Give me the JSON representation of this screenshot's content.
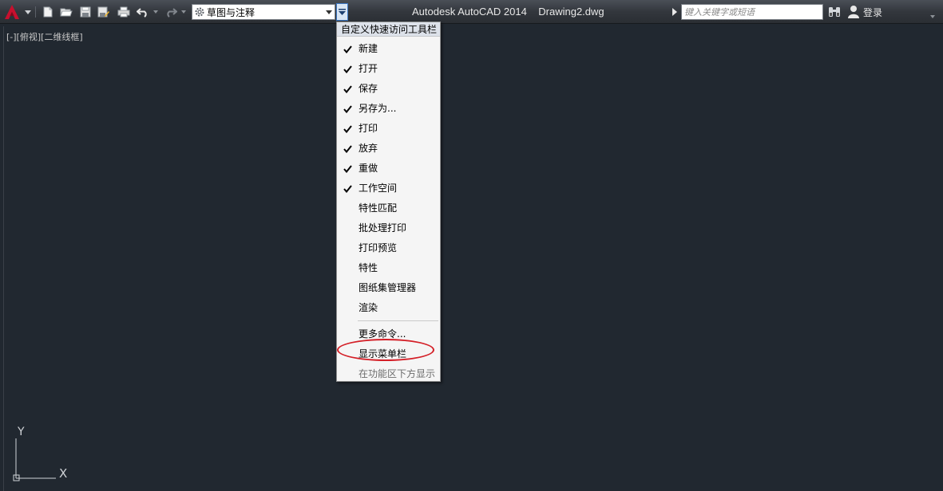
{
  "title_bar": {
    "window_title": "Autodesk AutoCAD 2014    Drawing2.dwg",
    "workspace": "草图与注释",
    "search_placeholder": "键入关键字或短语",
    "login": "登录"
  },
  "quick_access_icons": [
    "new-file-icon",
    "open-folder-icon",
    "save-icon",
    "save-as-icon",
    "print-icon",
    "undo-icon",
    "redo-icon"
  ],
  "viewport_label": "[-][俯视][二维线框]",
  "qat_menu": {
    "header": "自定义快速访问工具栏",
    "items": [
      {
        "label": "新建",
        "checked": true
      },
      {
        "label": "打开",
        "checked": true
      },
      {
        "label": "保存",
        "checked": true
      },
      {
        "label": "另存为...",
        "checked": true
      },
      {
        "label": "打印",
        "checked": true
      },
      {
        "label": "放弃",
        "checked": true
      },
      {
        "label": "重做",
        "checked": true
      },
      {
        "label": "工作空间",
        "checked": true
      },
      {
        "label": "特性匹配",
        "checked": false
      },
      {
        "label": "批处理打印",
        "checked": false
      },
      {
        "label": "打印预览",
        "checked": false
      },
      {
        "label": "特性",
        "checked": false
      },
      {
        "label": "图纸集管理器",
        "checked": false
      },
      {
        "label": "渲染",
        "checked": false
      }
    ],
    "more_commands": "更多命令...",
    "show_menu_bar": "显示菜单栏",
    "show_below_ribbon": "在功能区下方显示"
  },
  "ucs": {
    "y_label": "Y",
    "x_label": "X"
  },
  "colors": {
    "accent_red": "#d41f27",
    "canvas": "#212830",
    "menu_bg": "#f5f5f5"
  }
}
